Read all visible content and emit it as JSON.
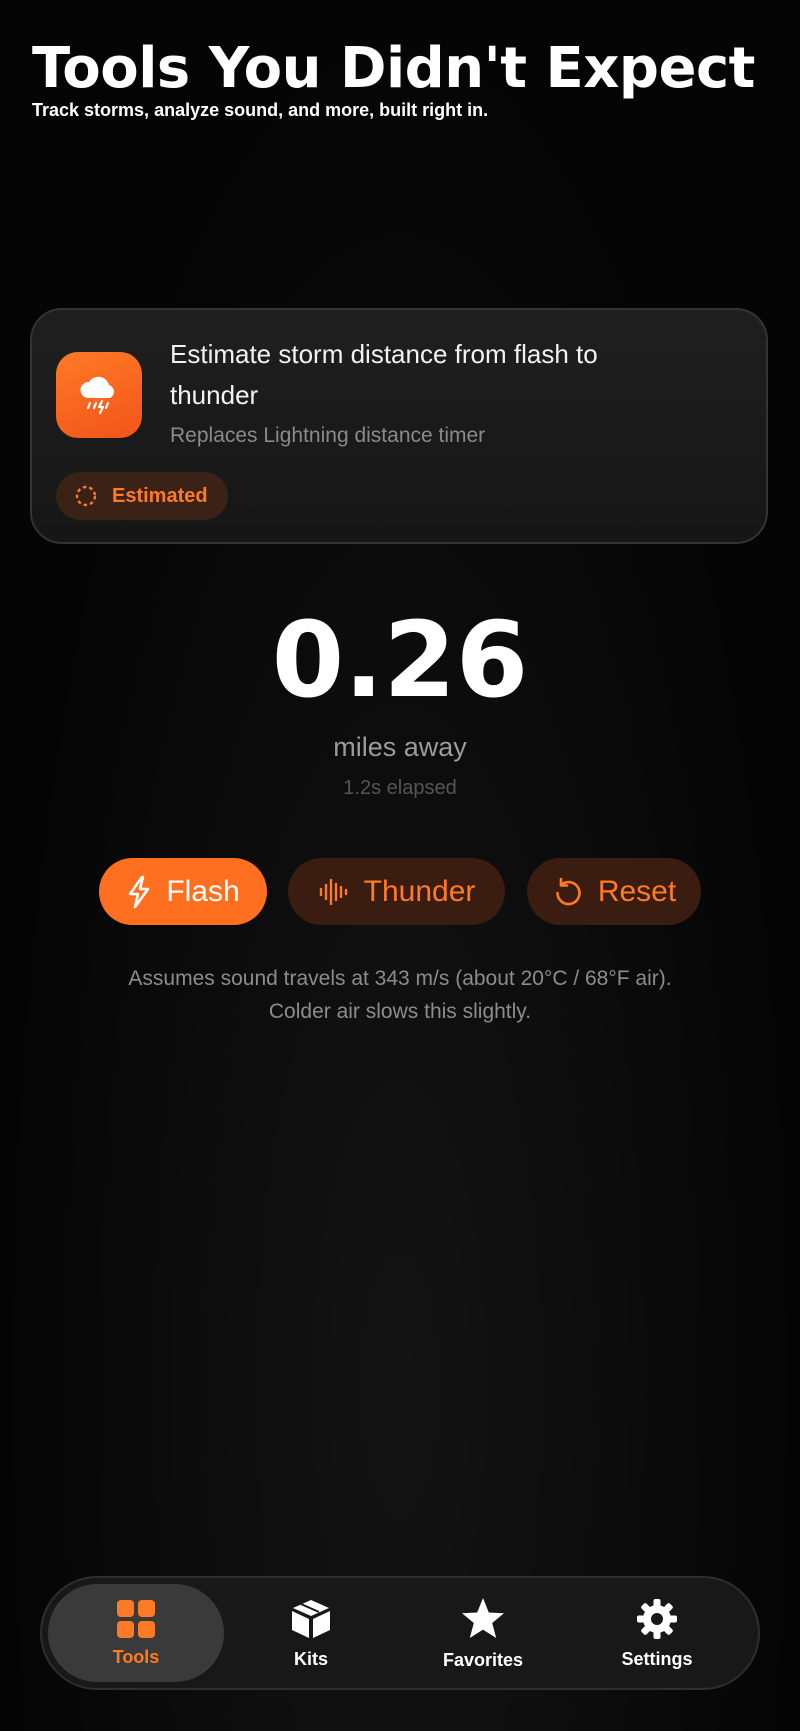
{
  "header": {
    "title": "Tools You Didn't Expect",
    "subtitle": "Track storms, analyze sound, and more, built right in."
  },
  "tool_card": {
    "icon": "storm-cloud-icon",
    "title": "Estimate storm distance from flash to thunder",
    "replaces": "Replaces Lightning distance timer",
    "badge": {
      "icon": "dashed-circle-icon",
      "label": "Estimated"
    }
  },
  "readout": {
    "distance": "0.26",
    "unit": "miles away",
    "elapsed": "1.2s elapsed"
  },
  "actions": {
    "flash": {
      "label": "Flash",
      "icon": "lightning-bolt-icon"
    },
    "thunder": {
      "label": "Thunder",
      "icon": "waveform-icon"
    },
    "reset": {
      "label": "Reset",
      "icon": "reset-arrow-icon"
    }
  },
  "note": {
    "line1": "Assumes sound travels at 343 m/s (about 20°C / 68°F air).",
    "line2": "Colder air slows this slightly."
  },
  "tabbar": {
    "tools": {
      "label": "Tools",
      "icon": "grid-icon",
      "active": true
    },
    "kits": {
      "label": "Kits",
      "icon": "box-icon",
      "active": false
    },
    "favorites": {
      "label": "Favorites",
      "icon": "star-icon",
      "active": false
    },
    "settings": {
      "label": "Settings",
      "icon": "gear-icon",
      "active": false
    }
  },
  "colors": {
    "accent": "#ff6f1f",
    "accent_dark": "#3a1d10",
    "background": "#030303",
    "card": "#1c1c1c"
  }
}
